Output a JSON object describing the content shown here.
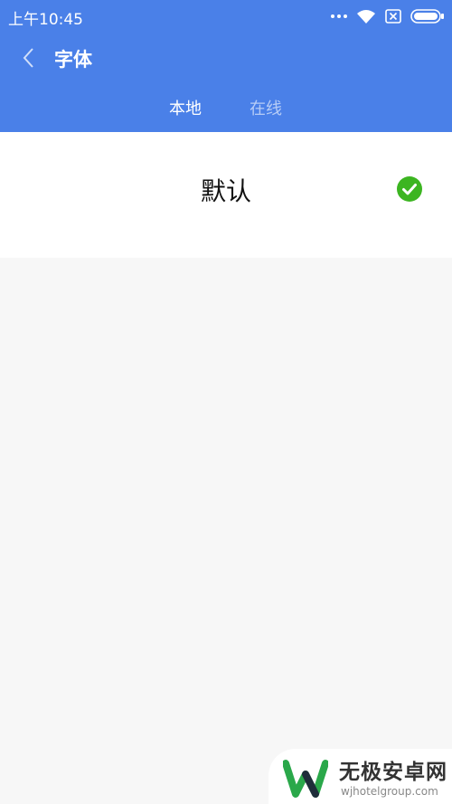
{
  "status_bar": {
    "time": "上午10:45",
    "icons": [
      "more-dots-icon",
      "wifi-icon",
      "no-sim-icon",
      "battery-icon"
    ]
  },
  "header": {
    "title": "字体",
    "back_icon": "chevron-left-icon",
    "tabs": [
      {
        "label": "本地",
        "active": true
      },
      {
        "label": "在线",
        "active": false
      }
    ]
  },
  "font_list": [
    {
      "name": "默认",
      "selected": true,
      "status_icon": "check-circle-icon"
    }
  ],
  "watermark": {
    "brand": "无极安卓网",
    "url": "wjhotelgroup.com"
  },
  "colors": {
    "header": "#4a80e8",
    "check": "#3cb521",
    "background": "#f7f7f7"
  }
}
